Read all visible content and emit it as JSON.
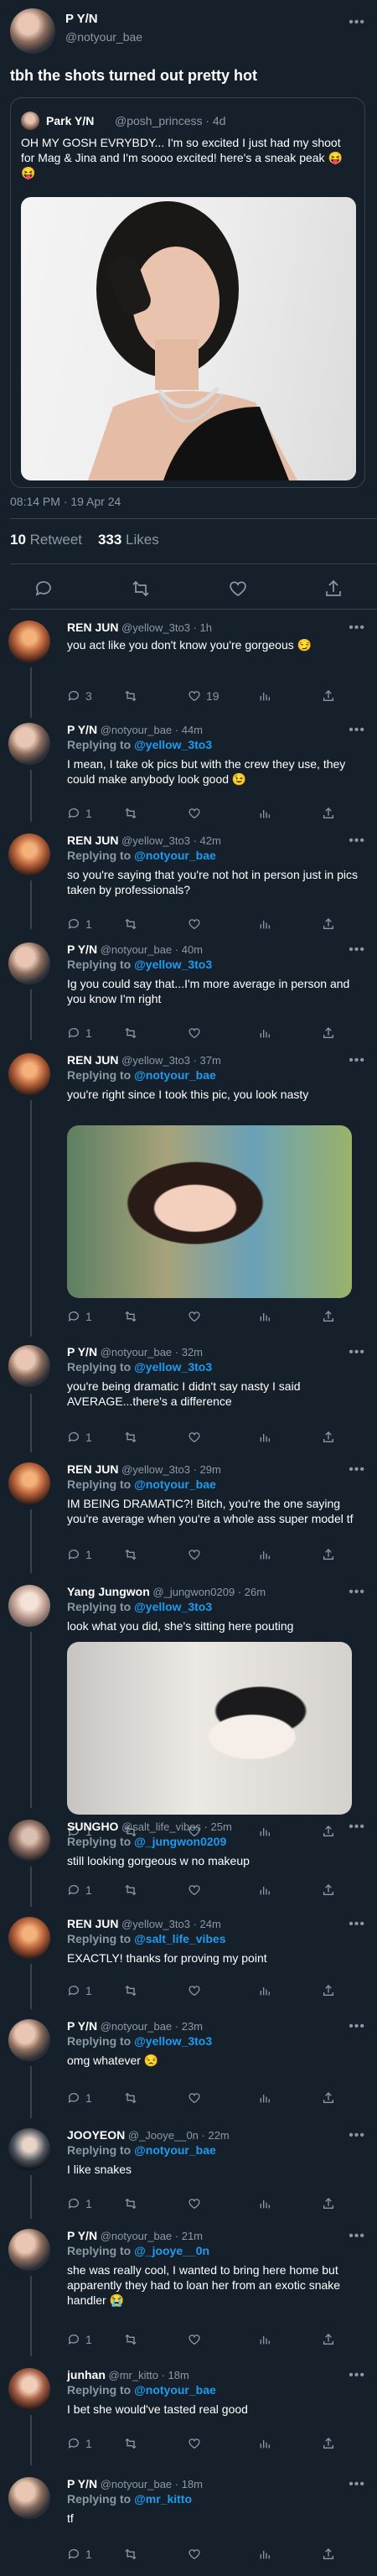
{
  "main": {
    "name": "P Y/N",
    "handle": "@notyour_bae",
    "text": "tbh the shots turned out pretty hot",
    "quote": {
      "name": "Park Y/N",
      "handle": "@posh_princess · 4d",
      "text": "OH MY GOSH EVRYBDY... I'm so excited I just had my shoot for Mag & Jina and I'm soooo excited! here's a sneak peak 😝😝"
    },
    "timestamp": "08:14 PM · 19 Apr 24",
    "retweets": "10",
    "retweets_label": "Retweet",
    "likes": "333",
    "likes_label": "Likes"
  },
  "replies": [
    {
      "name": "REN JUN",
      "handle": "@yellow_3to3 · 1h",
      "replying": "",
      "text": "you act like you don't know you're gorgeous 😏",
      "replies": "3",
      "likes": "19"
    },
    {
      "name": "P Y/N",
      "handle": "@notyour_bae · 44m",
      "replying": "@yellow_3to3",
      "text": "I mean, I take ok pics but with the crew they use, they could make anybody look good 😉",
      "replies": "1",
      "likes": ""
    },
    {
      "name": "REN JUN",
      "handle": "@yellow_3to3 · 42m",
      "replying": "@notyour_bae",
      "text": "so you're saying that you're not hot in person just in pics taken by professionals?",
      "replies": "1",
      "likes": ""
    },
    {
      "name": "P Y/N",
      "handle": "@notyour_bae · 40m",
      "replying": "@yellow_3to3",
      "text": "Ig you could say that...I'm more average in person and you know I'm right",
      "replies": "1",
      "likes": ""
    },
    {
      "name": "REN JUN",
      "handle": "@yellow_3to3 · 37m",
      "replying": "@notyour_bae",
      "text": "you're right since I took this pic, you look nasty",
      "replies": "1",
      "likes": ""
    },
    {
      "name": "P Y/N",
      "handle": "@notyour_bae · 32m",
      "replying": "@yellow_3to3",
      "text": "you're being dramatic I didn't say nasty I said AVERAGE...there's a difference",
      "replies": "1",
      "likes": ""
    },
    {
      "name": "REN JUN",
      "handle": "@yellow_3to3 · 29m",
      "replying": "@notyour_bae",
      "text": "IM BEING DRAMATIC?! Bitch, you're the one saying you're average when you're a whole ass super model tf",
      "replies": "1",
      "likes": ""
    },
    {
      "name": "Yang Jungwon",
      "handle": "@_jungwon0209 · 26m",
      "replying": "@yellow_3to3",
      "text": "look what you did, she's sitting here pouting",
      "replies": "1",
      "likes": ""
    },
    {
      "name": "SUNGHO",
      "handle": "@salt_life_vibes · 25m",
      "replying": "@_jungwon0209",
      "text": "still looking gorgeous w no makeup",
      "replies": "1",
      "likes": ""
    },
    {
      "name": "REN JUN",
      "handle": "@yellow_3to3 · 24m",
      "replying": "@salt_life_vibes",
      "text": "EXACTLY! thanks for proving my point",
      "replies": "1",
      "likes": ""
    },
    {
      "name": "P Y/N",
      "handle": "@notyour_bae · 23m",
      "replying": "@yellow_3to3",
      "text": "omg whatever 😒",
      "replies": "1",
      "likes": ""
    },
    {
      "name": "JOOYEON",
      "handle": "@_Jooye__0n · 22m",
      "replying": "@notyour_bae",
      "text": "I like snakes",
      "replies": "1",
      "likes": ""
    },
    {
      "name": "P Y/N",
      "handle": "@notyour_bae · 21m",
      "replying": "@_jooye__0n",
      "text": "she was really cool, I wanted to bring here home but apparently they had to loan her from an exotic snake handler 😭",
      "replies": "1",
      "likes": ""
    },
    {
      "name": "junhan",
      "handle": "@mr_kitto · 18m",
      "replying": "@notyour_bae",
      "text": "I bet she would've tasted real good",
      "replies": "1",
      "likes": ""
    },
    {
      "name": "P Y/N",
      "handle": "@notyour_bae · 18m",
      "replying": "@mr_kitto",
      "text": "tf",
      "replies": "1",
      "likes": ""
    }
  ],
  "ui": {
    "more": "•••",
    "replying_to": "Replying to"
  }
}
